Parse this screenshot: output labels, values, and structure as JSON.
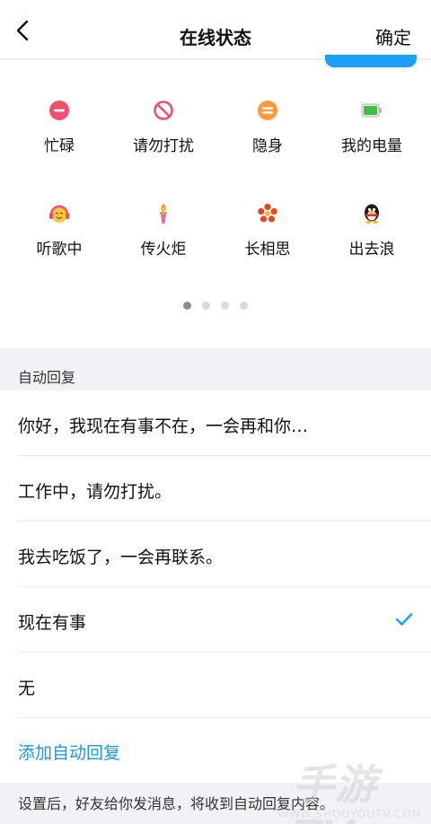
{
  "header": {
    "title": "在线状态",
    "confirm_label": "确定"
  },
  "status_grid": [
    {
      "label": "忙碌",
      "icon": "busy-icon"
    },
    {
      "label": "请勿打扰",
      "icon": "do-not-disturb-icon"
    },
    {
      "label": "隐身",
      "icon": "invisible-icon"
    },
    {
      "label": "我的电量",
      "icon": "battery-icon"
    },
    {
      "label": "听歌中",
      "icon": "headphones-face-icon"
    },
    {
      "label": "传火炬",
      "icon": "torch-icon"
    },
    {
      "label": "长相思",
      "icon": "flower-icon"
    },
    {
      "label": "出去浪",
      "icon": "penguin-icon"
    }
  ],
  "pager": {
    "pages": 4,
    "current": 1
  },
  "auto_reply": {
    "section_title": "自动回复",
    "items": [
      {
        "text": "你好，我现在有事不在，一会再和你…",
        "selected": false
      },
      {
        "text": "工作中，请勿打扰。",
        "selected": false
      },
      {
        "text": "我去吃饭了，一会再联系。",
        "selected": false
      },
      {
        "text": "现在有事",
        "selected": true
      },
      {
        "text": "无",
        "selected": false
      }
    ],
    "add_label": "添加自动回复"
  },
  "footer_note": "设置后，好友给你发消息，将收到自动回复内容。",
  "watermark": {
    "brand": "手游TV",
    "url": "WWW.SHOUYOUTV.COM"
  },
  "colors": {
    "accent": "#1aa1f6",
    "link": "#1f95e8",
    "busy": "#f0506e",
    "invisible": "#ff9a3c",
    "battery": "#3fbf4a"
  }
}
